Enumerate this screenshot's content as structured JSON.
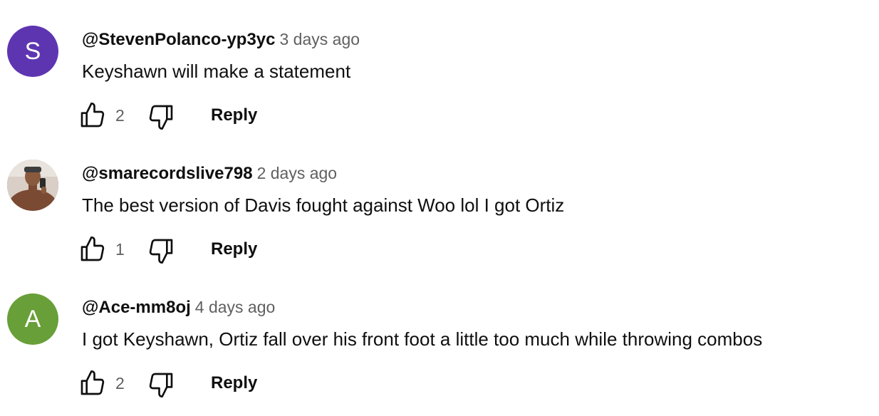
{
  "comments": [
    {
      "avatar_letter": "S",
      "avatar_color": "#5e35b1",
      "author": "@StevenPolanco-yp3yc",
      "time": "3 days ago",
      "text": "Keyshawn will make a statement",
      "likes": "2",
      "reply_label": "Reply"
    },
    {
      "avatar_letter": "",
      "avatar_color": "#8a5a44",
      "author": "@smarecordslive798",
      "time": "2 days ago",
      "text": "The best version of Davis fought against Woo lol I got Ortiz",
      "likes": "1",
      "reply_label": "Reply"
    },
    {
      "avatar_letter": "A",
      "avatar_color": "#689f38",
      "author": "@Ace-mm8oj",
      "time": "4 days ago",
      "text": "I got Keyshawn, Ortiz fall over his front foot a little too much while throwing combos",
      "likes": "2",
      "reply_label": "Reply"
    }
  ],
  "icons": {
    "like": "thumbs-up-icon",
    "dislike": "thumbs-down-icon"
  }
}
